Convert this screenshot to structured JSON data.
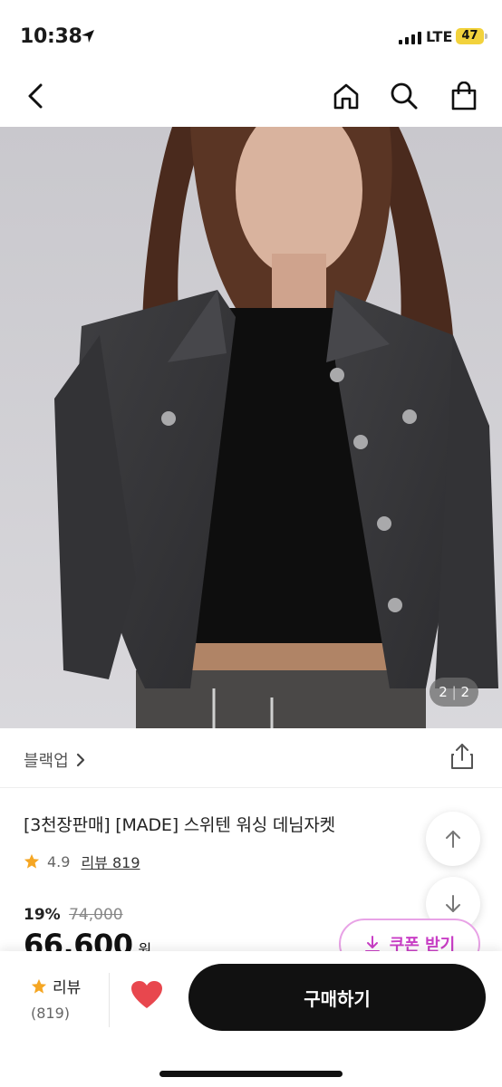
{
  "status_bar": {
    "time": "10:38",
    "network": "LTE",
    "battery": "47"
  },
  "nav": {
    "back_icon": "chevron-left-icon",
    "home_icon": "home-icon",
    "search_icon": "search-icon",
    "cart_icon": "shopping-bag-icon"
  },
  "gallery": {
    "current": "2",
    "separator": "|",
    "total": "2"
  },
  "brand": {
    "name": "블랙업"
  },
  "product": {
    "title": "[3천장판매] [MADE] 스위텐 워싱 데님자켓",
    "rating": "4.9",
    "review_label": "리뷰 819",
    "discount_rate": "19%",
    "original_price": "74,000",
    "sale_price": "66,600",
    "currency": "원",
    "coupon_label": "쿠폰 받기"
  },
  "bottom_bar": {
    "review_label": "리뷰",
    "review_count": "(819)",
    "buy_label": "구매하기"
  },
  "colors": {
    "accent_pink": "#c93ec6",
    "heart_red": "#e8474e",
    "star_orange": "#f5a623",
    "buy_button": "#111111"
  }
}
